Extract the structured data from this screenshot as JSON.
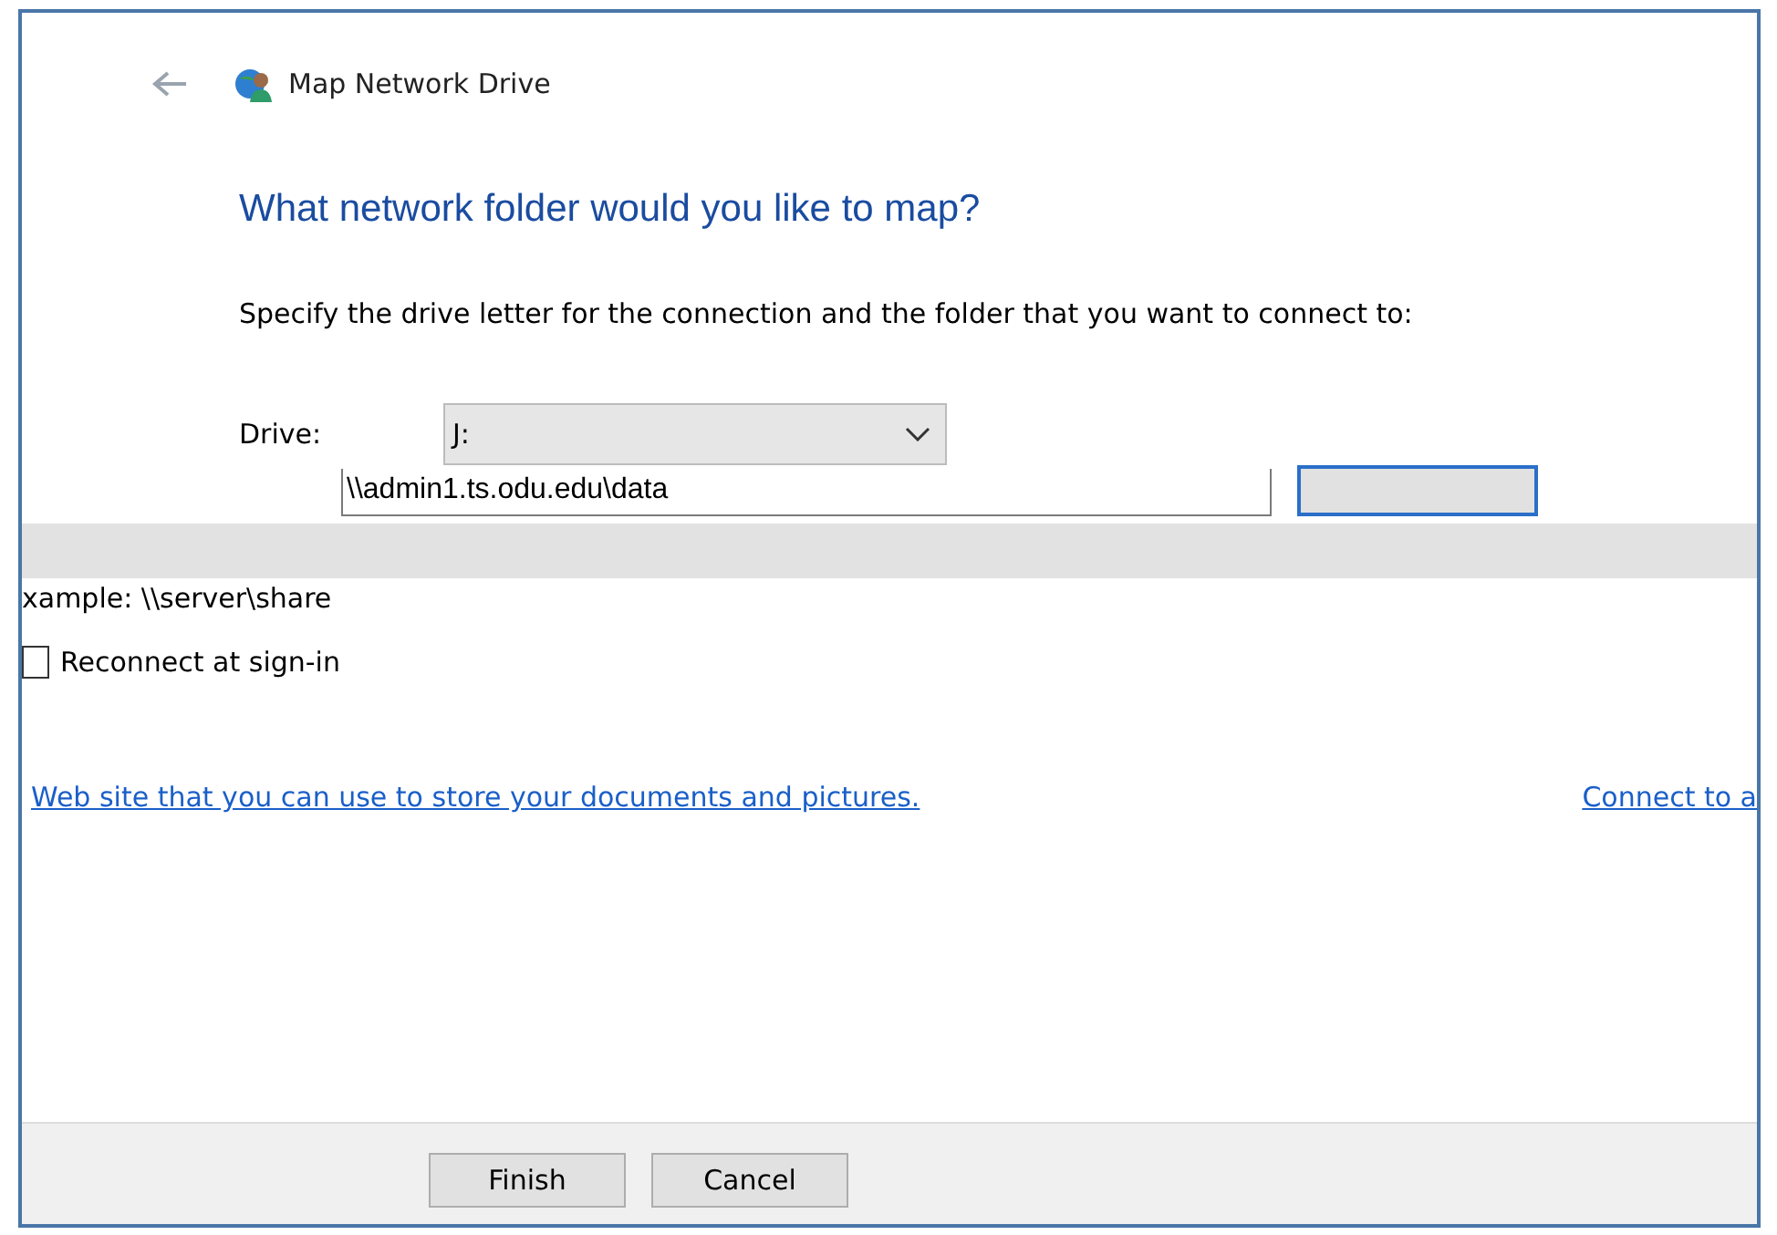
{
  "window": {
    "title": "Map Network Drive"
  },
  "heading": "What network folder would you like to map?",
  "instruction": "Specify the drive letter for the connection and the folder that you want to connect to:",
  "drive": {
    "label": "Drive:",
    "value": "J:"
  },
  "folder": {
    "value": "\\\\admin1.ts.odu.edu\\data"
  },
  "example": "xample: \\\\server\\share",
  "reconnect": {
    "label": "Reconnect at sign-in",
    "checked": false
  },
  "links": [
    "Web site that you can use to store your documents and pictures.",
    "Connect to a"
  ],
  "buttons": [
    "Finish",
    "Cancel"
  ]
}
